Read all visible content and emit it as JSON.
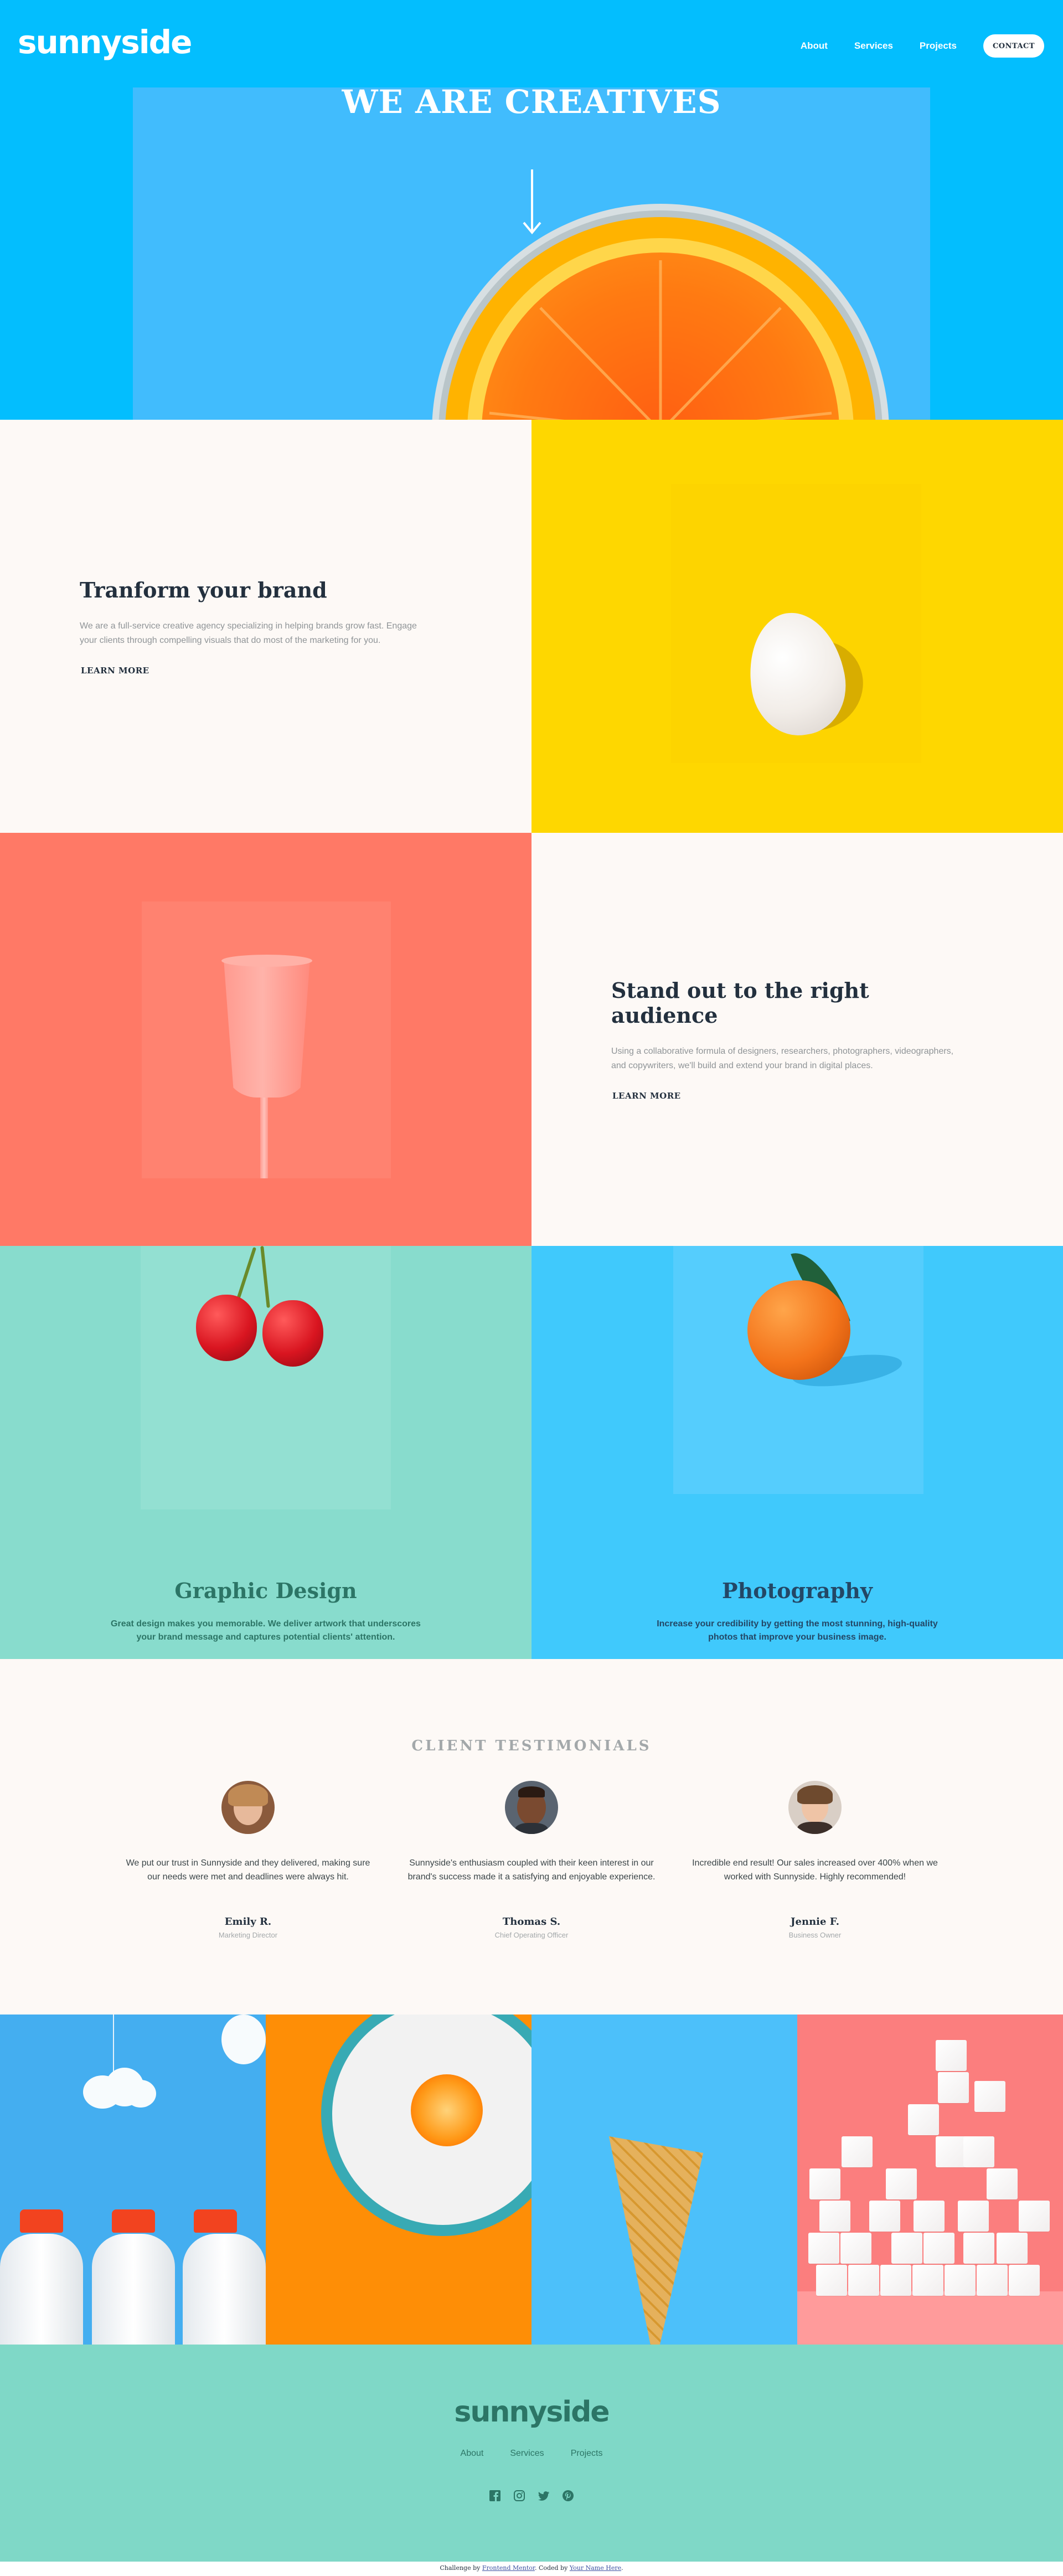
{
  "nav": {
    "logo": "sunnyside",
    "links": [
      "About",
      "Services",
      "Projects"
    ],
    "contact": "CONTACT"
  },
  "hero": {
    "title": "WE ARE CREATIVES",
    "arrow_icon": "arrow-down-icon"
  },
  "features": [
    {
      "title": "Tranform your brand",
      "body": "We are a full-service creative agency specializing in helping brands grow fast. Engage your clients through compelling visuals that do most of the marketing for you.",
      "link": "LEARN MORE",
      "accent": "#fed500"
    },
    {
      "title": "Stand out to the right audience",
      "body": "Using a collaborative formula of designers, researchers, photographers, videographers, and copywriters, we'll build and extend your brand in digital places.",
      "link": "LEARN MORE",
      "accent": "#ff7b63"
    }
  ],
  "services": [
    {
      "title": "Graphic Design",
      "body": "Great design makes you memorable. We deliver artwork that underscores your brand message and captures potential clients' attention.",
      "color": "#2c7566"
    },
    {
      "title": "Photography",
      "body": "Increase your credibility by getting the most stunning, high-quality photos that improve your business image.",
      "color": "#234766"
    }
  ],
  "testimonials": {
    "title": "CLIENT TESTIMONIALS",
    "items": [
      {
        "quote": "We put our trust in Sunnyside and they delivered, making sure our needs were met and deadlines were always hit.",
        "name": "Emily R.",
        "role": "Marketing Director"
      },
      {
        "quote": "Sunnyside's enthusiasm coupled with their keen interest in our brand's success made it a satisfying and enjoyable experience.",
        "name": "Thomas S.",
        "role": "Chief Operating Officer"
      },
      {
        "quote": "Incredible end result! Our sales increased over 400% when we worked with Sunnyside. Highly recommended!",
        "name": "Jennie F.",
        "role": "Business Owner"
      }
    ]
  },
  "footer": {
    "logo": "sunnyside",
    "links": [
      "About",
      "Services",
      "Projects"
    ],
    "social_icons": [
      "facebook-icon",
      "instagram-icon",
      "twitter-icon",
      "pinterest-icon"
    ]
  },
  "attribution": {
    "prefix": "Challenge by",
    "source": "Frontend Mentor",
    "middle": ". Coded by",
    "author": "Your Name Here",
    "suffix": "."
  },
  "colors": {
    "hero_blue": "#03befe",
    "yellow": "#fed700",
    "coral": "#ff7966",
    "green": "#88dccd",
    "light_blue": "#40c9fc",
    "footer_green": "#7fd8c7",
    "dark_text": "#23303e"
  }
}
